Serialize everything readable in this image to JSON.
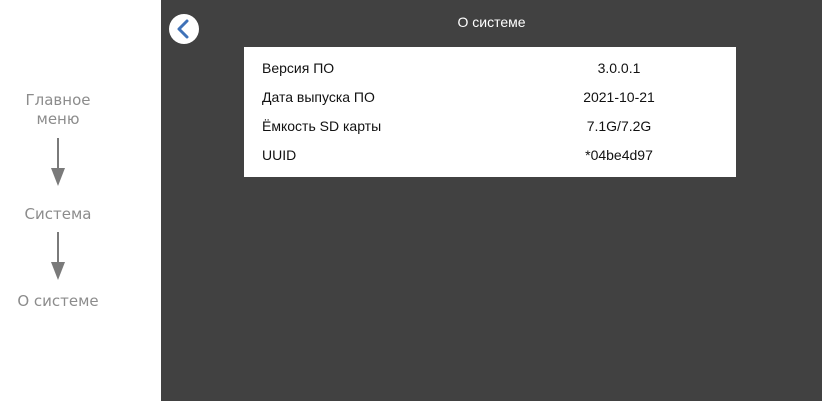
{
  "navigation_path": {
    "steps": [
      "Главное\nменю",
      "Система",
      "О системе"
    ],
    "arrow_icon": "arrow-down-icon"
  },
  "screen": {
    "title": "О системе",
    "back_icon": "chevron-left-icon",
    "colors": {
      "background": "#414141",
      "panel": "#ffffff",
      "accent": "#3f72b8"
    },
    "rows": [
      {
        "label": "Версия ПО",
        "value": "3.0.0.1"
      },
      {
        "label": "Дата выпуска ПО",
        "value": "2021-10-21"
      },
      {
        "label": "Ёмкость SD карты",
        "value": "7.1G/7.2G"
      },
      {
        "label": "UUID",
        "value": "*04be4d97"
      }
    ]
  }
}
